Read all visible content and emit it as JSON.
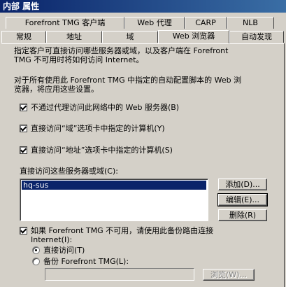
{
  "window": {
    "title": "内部 属性"
  },
  "tabs_back": [
    {
      "label": "Forefront TMG 客户端"
    },
    {
      "label": "Web 代理"
    },
    {
      "label": "CARP"
    },
    {
      "label": "NLB"
    }
  ],
  "tabs_front": [
    {
      "label": "常规"
    },
    {
      "label": "地址"
    },
    {
      "label": "域"
    },
    {
      "label": "Web 浏览器"
    },
    {
      "label": "自动发现"
    }
  ],
  "desc": {
    "line1": "指定客户可直接访问哪些服务器或域，以及客户端在 Forefront",
    "line2": "TMG 不可用时将如何访问 Internet。",
    "line3": "对于所有使用此 Forefront TMG 中指定的自动配置脚本的 Web 浏",
    "line4": "览器，将应用这些设置。"
  },
  "checkboxes": [
    {
      "label": "不通过代理访问此网络中的 Web 服务器(B)",
      "checked": true
    },
    {
      "label": "直接访问“域”选项卡中指定的计算机(Y)",
      "checked": true
    },
    {
      "label": "直接访问“地址”选项卡中指定的计算机(S)",
      "checked": true
    }
  ],
  "list": {
    "label": "直接访问这些服务器或域(C):",
    "items": [
      "hq-sus"
    ]
  },
  "buttons": {
    "add": "添加(D)...",
    "edit": "编辑(E)...",
    "delete": "删除(R)",
    "browse": "浏览(W)..."
  },
  "backup": {
    "label1": "如果 Forefront TMG 不可用，请使用此备份路由连接",
    "label2": "Internet(I):",
    "checked": true,
    "radio_direct": "直接访问(T)",
    "radio_backup": "备份 Forefront TMG(L):",
    "field_value": ""
  }
}
